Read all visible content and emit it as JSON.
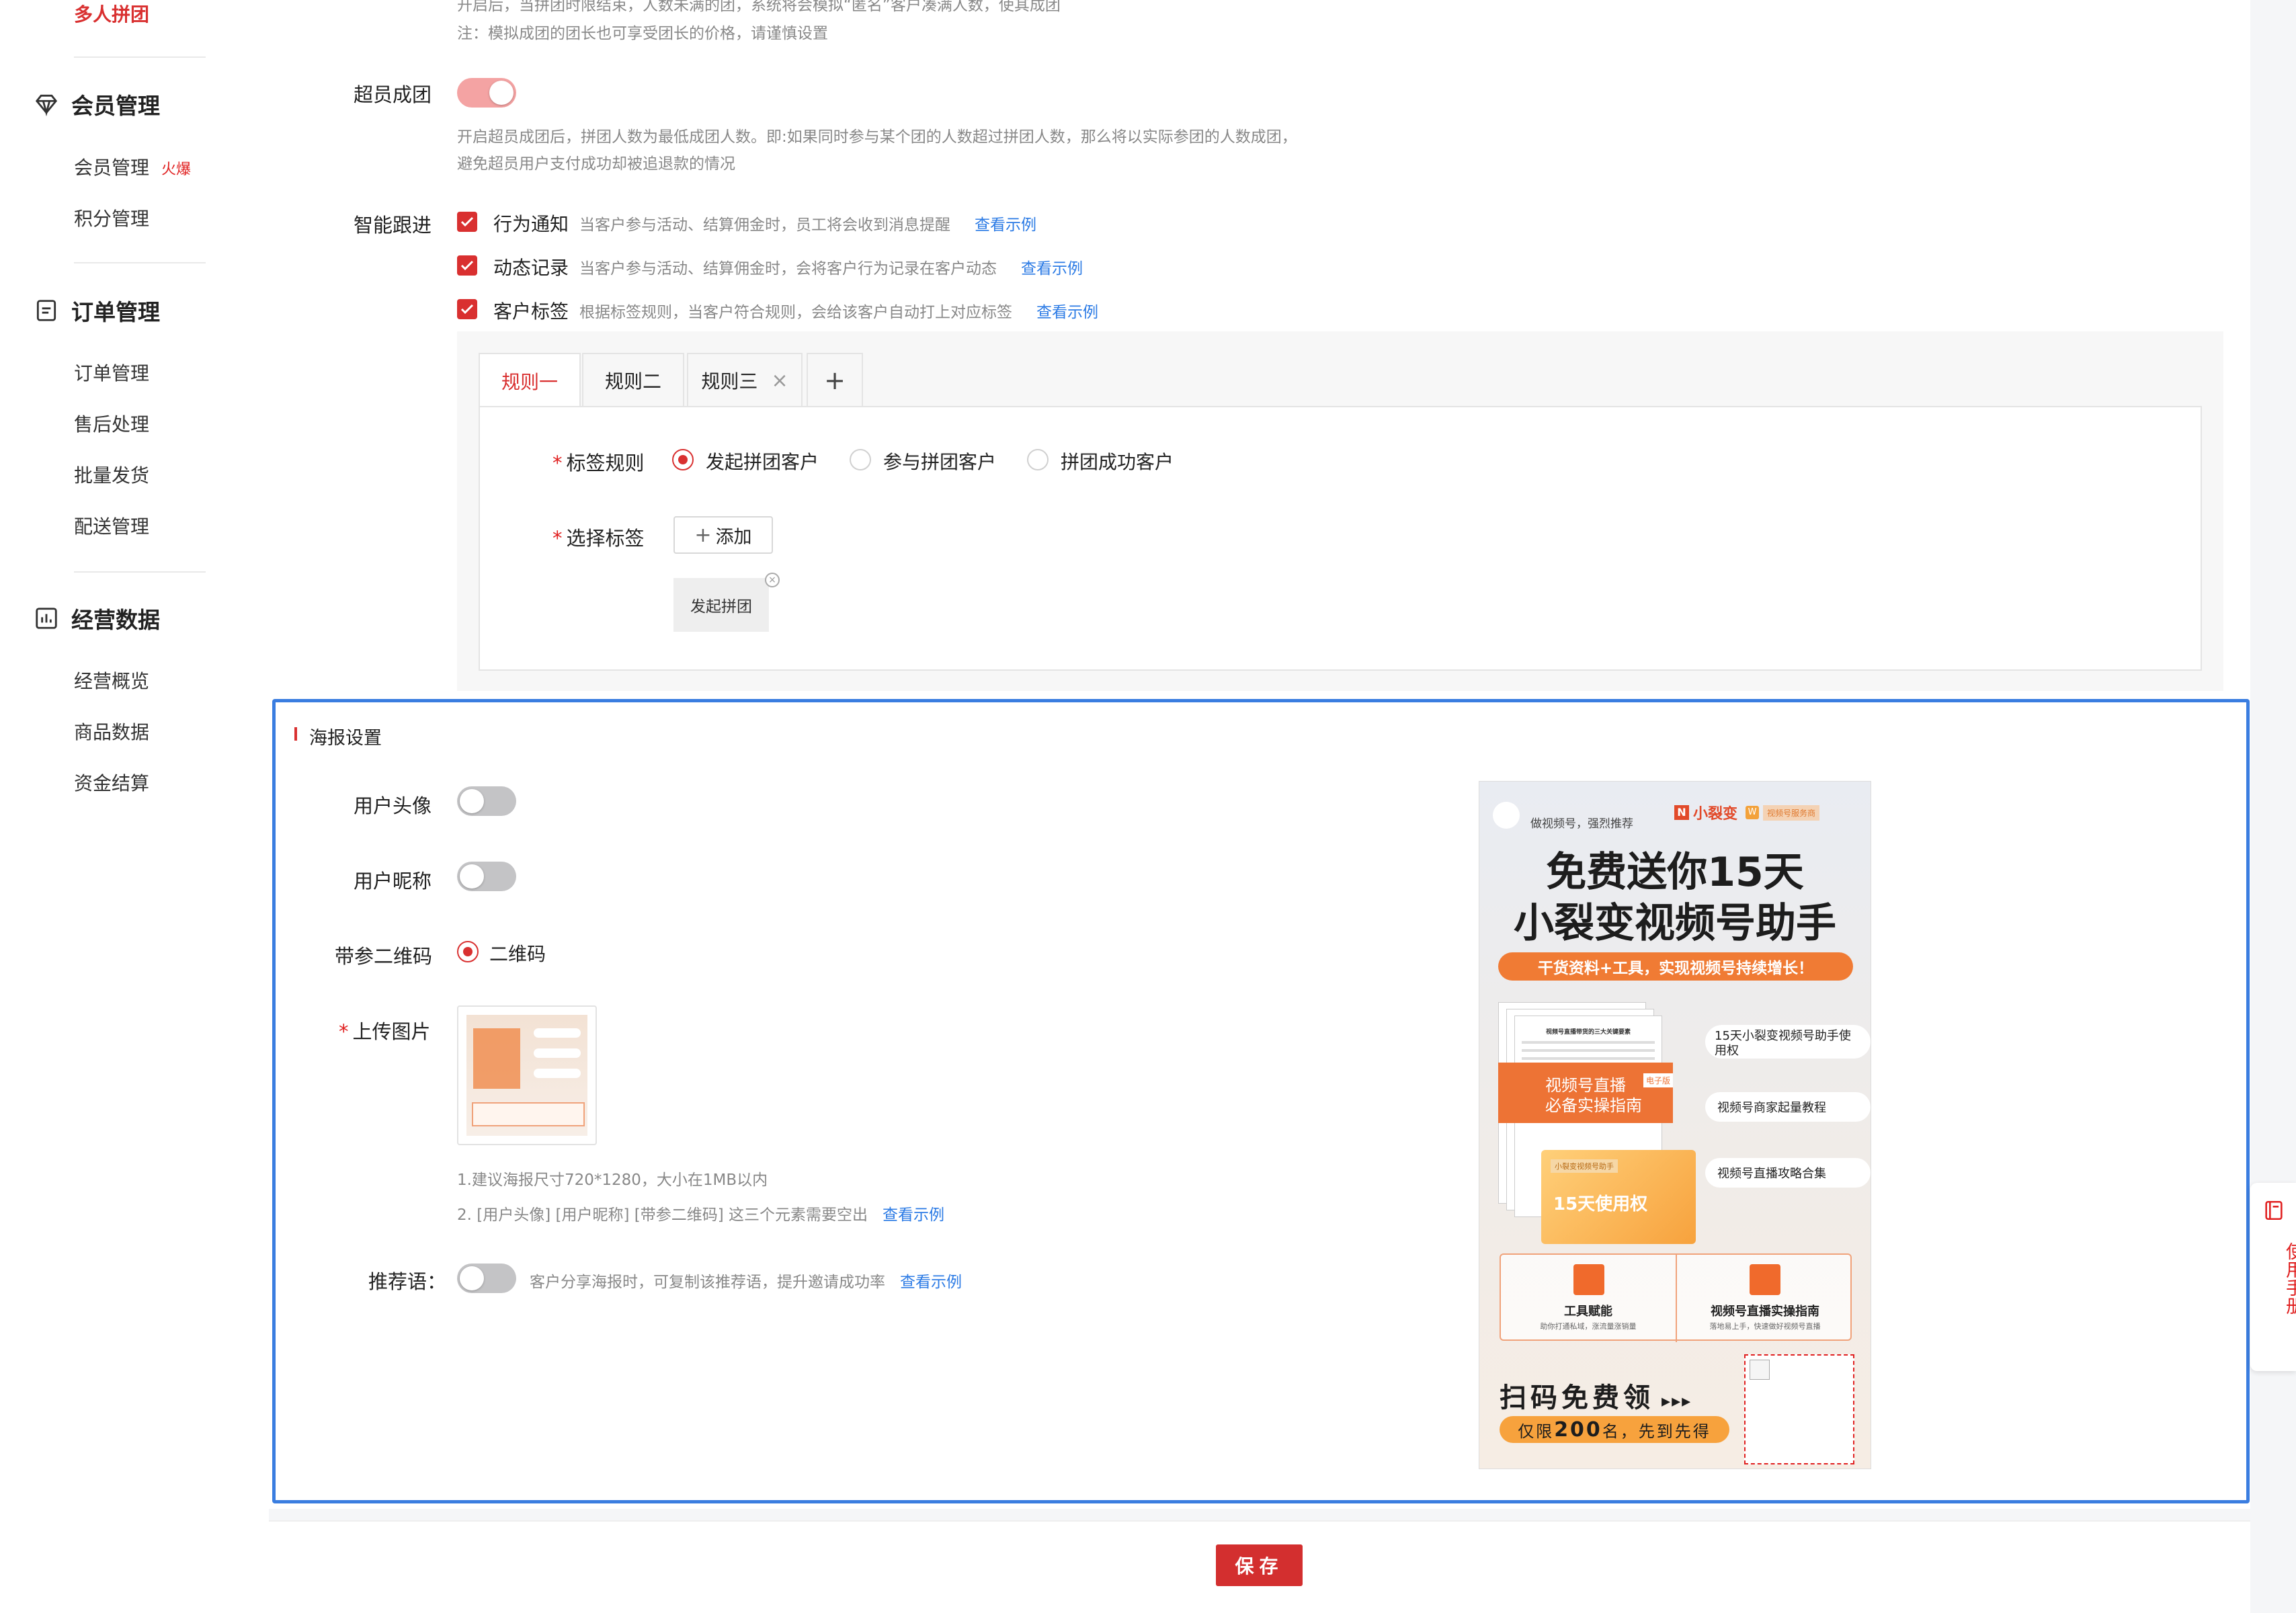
{
  "sidebar": {
    "top_item": "多人拼团",
    "groups": [
      {
        "title": "会员管理",
        "icon": "diamond-icon",
        "items": [
          "会员管理",
          "积分管理"
        ],
        "badge": "火爆"
      },
      {
        "title": "订单管理",
        "icon": "document-icon",
        "items": [
          "订单管理",
          "售后处理",
          "批量发货",
          "配送管理"
        ]
      },
      {
        "title": "经营数据",
        "icon": "bar-chart-icon",
        "items": [
          "经营概览",
          "商品数据",
          "资金结算"
        ]
      }
    ]
  },
  "top_hint": {
    "line1": "开启后，当拼团时限结束，人数未满的团，系统将会模拟“匿名”客户凑满人数，使其成团",
    "line2": "注：模拟成团的团长也可享受团长的价格，请谨慎设置"
  },
  "over_group": {
    "label": "超员成团",
    "enabled": true,
    "hint1": "开启超员成团后，拼团人数为最低成团人数。即:如果同时参与某个团的人数超过拼团人数，那么将以实际参团的人数成团，",
    "hint2": "避免超员用户支付成功却被追退款的情况"
  },
  "smart_follow": {
    "label": "智能跟进",
    "items": [
      {
        "title": "行为通知",
        "desc": "当客户参与活动、结算佣金时，员工将会收到消息提醒",
        "link": "查看示例"
      },
      {
        "title": "动态记录",
        "desc": "当客户参与活动、结算佣金时，会将客户行为记录在客户动态",
        "link": "查看示例"
      },
      {
        "title": "客户标签",
        "desc": "根据标签规则，当客户符合规则，会给该客户自动打上对应标签",
        "link": "查看示例"
      }
    ]
  },
  "rule_tabs": {
    "tabs": [
      "规则一",
      "规则二",
      "规则三"
    ],
    "add": "+",
    "close": "×",
    "tag_rule_label": "标签规则",
    "tag_rule_options": [
      "发起拼团客户",
      "参与拼团客户",
      "拼团成功客户"
    ],
    "select_tag_label": "选择标签",
    "add_button": "添加",
    "selected_tag": "发起拼团"
  },
  "poster": {
    "section_title": "海报设置",
    "avatar_label": "用户头像",
    "nickname_label": "用户昵称",
    "qrcode_label": "带参二维码",
    "qrcode_option": "二维码",
    "upload_label": "上传图片",
    "upload_hint1": "1.建议海报尺寸720*1280，大小在1MB以内",
    "upload_hint2": "2. [用户头像] [用户昵称] [带参二维码] 这三个元素需要空出",
    "upload_hint_link": "查看示例",
    "recommend_label": "推荐语：",
    "recommend_hint": "客户分享海报时，可复制该推荐语，提升邀请成功率",
    "recommend_link": "查看示例"
  },
  "preview": {
    "top_tag": "做视频号，强烈推荐",
    "brand": "小裂变",
    "brand2": "视频号服务商",
    "headline1": "免费送你15天",
    "headline2": "小裂变视频号助手",
    "banner": "干货资料+工具，实现视频号持续增长！",
    "book_title1": "视频号直播",
    "book_title2": "必备实操指南",
    "book_badge": "电子版",
    "book_doc": "视频号直播带货的三大关键要素",
    "card_tag": "小裂变视频号助手",
    "card_text": "15天使用权",
    "bubbles": [
      "15天小裂变视频号助手使用权",
      "视频号商家起量教程",
      "视频号直播攻略合集"
    ],
    "box1_title": "工具赋能",
    "box1_sub": "助你打通私域，涨流量涨销量",
    "box2_title": "视频号直播实操指南",
    "box2_sub": "落地易上手，快速做好视频号直播",
    "cta": "扫码免费领",
    "limit_prefix": "仅限",
    "limit_num": "200",
    "limit_suffix": "名，先到先得"
  },
  "footer": {
    "save": "保存"
  },
  "manual": {
    "text": "使用手册"
  },
  "colors": {
    "accent": "#d93030",
    "link": "#2c7be5",
    "focus_border": "#3a7de0"
  }
}
